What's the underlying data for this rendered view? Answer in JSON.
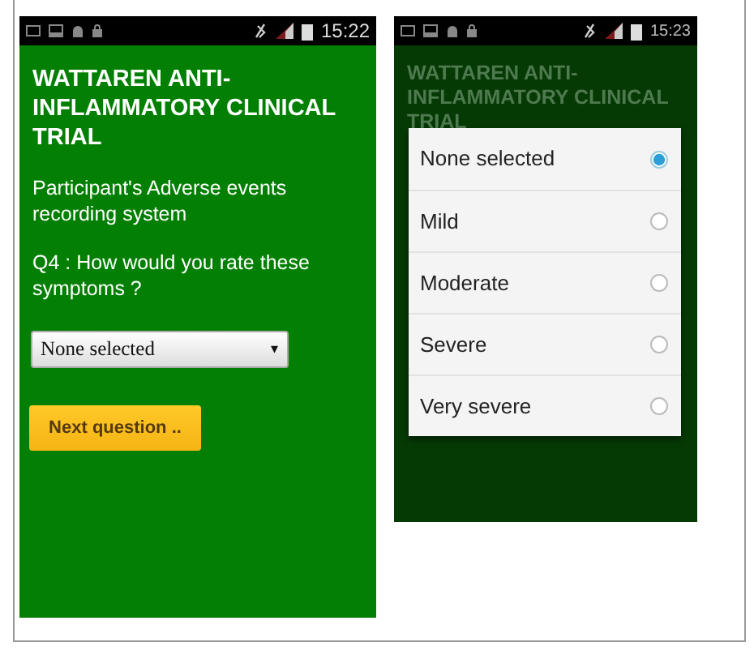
{
  "screens": [
    {
      "status_bar": {
        "time": "15:22"
      },
      "title": "WATTAREN ANTI-INFLAMMATORY CLINICAL TRIAL",
      "subtitle": "Participant's Adverse events recording system",
      "question": "Q4 : How would you rate these symptoms ?",
      "dropdown": {
        "value": "None selected",
        "caret": "▾"
      },
      "button": "Next question .."
    },
    {
      "status_bar": {
        "time": "15:23"
      },
      "title": "WATTAREN ANTI-INFLAMMATORY CLINICAL TRIAL",
      "options": [
        {
          "label": "None selected",
          "selected": true
        },
        {
          "label": "Mild",
          "selected": false
        },
        {
          "label": "Moderate",
          "selected": false
        },
        {
          "label": "Severe",
          "selected": false
        },
        {
          "label": "Very severe",
          "selected": false
        }
      ]
    }
  ]
}
